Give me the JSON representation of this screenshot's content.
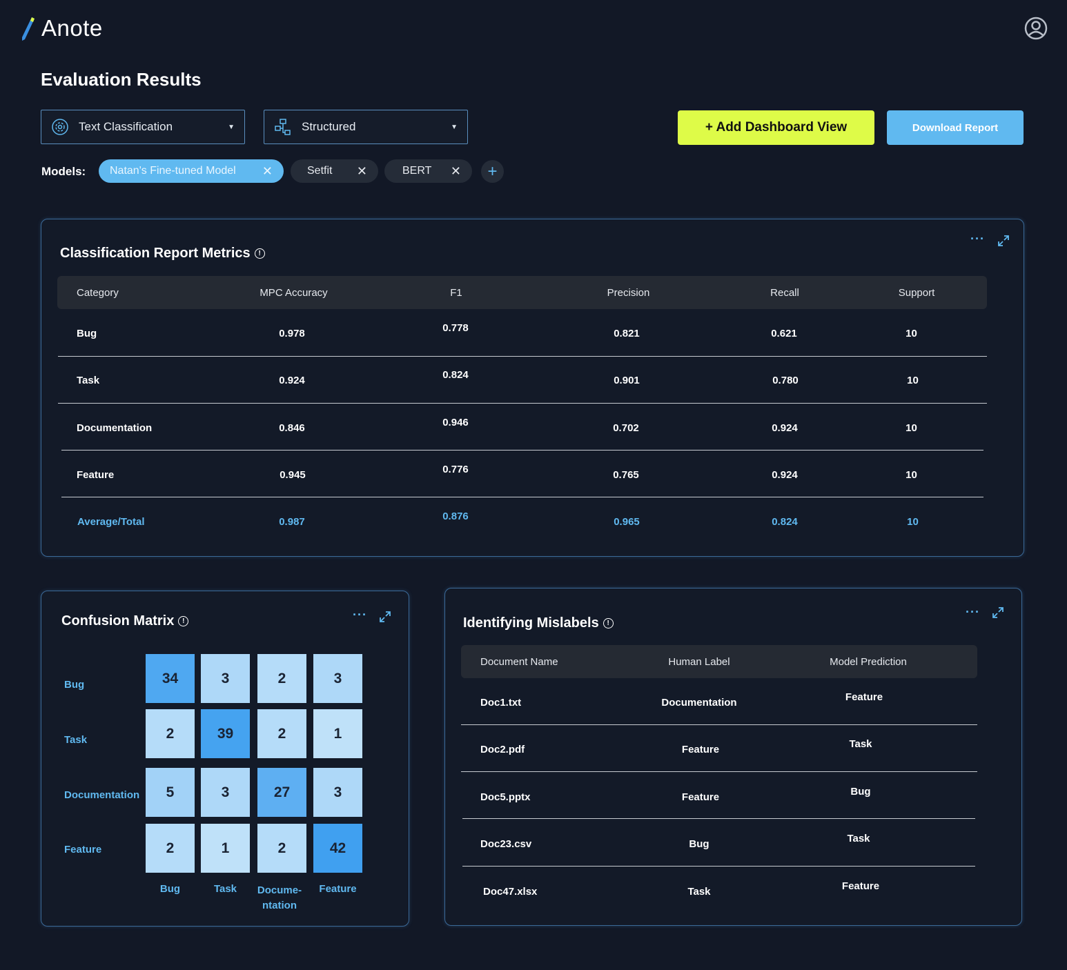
{
  "app": {
    "name": "Anote"
  },
  "page": {
    "title": "Evaluation Results"
  },
  "filters": {
    "task_select": {
      "value": "Text Classification",
      "icon": "gear-icon"
    },
    "data_select": {
      "value": "Structured",
      "icon": "flowchart-icon"
    }
  },
  "actions": {
    "add_dashboard": "+ Add Dashboard View",
    "download_report": "Download Report"
  },
  "models": {
    "label": "Models:",
    "chips": [
      {
        "label": "Natan's Fine-tuned Model",
        "active": true
      },
      {
        "label": "Setfit",
        "active": false
      },
      {
        "label": "BERT",
        "active": false
      }
    ],
    "add_label": "+"
  },
  "classification_report": {
    "title": "Classification Report Metrics",
    "columns": [
      "Category",
      "MPC Accuracy",
      "F1",
      "Precision",
      "Recall",
      "Support"
    ],
    "rows": [
      [
        "Bug",
        "0.978",
        "0.778",
        "0.821",
        "0.621",
        "10"
      ],
      [
        "Task",
        "0.924",
        "0.824",
        "0.901",
        "0.780",
        "10"
      ],
      [
        "Documentation",
        "0.846",
        "0.946",
        "0.702",
        "0.924",
        "10"
      ],
      [
        "Feature",
        "0.945",
        "0.776",
        "0.765",
        "0.924",
        "10"
      ]
    ],
    "total": [
      "Average/Total",
      "0.987",
      "0.876",
      "0.965",
      "0.824",
      "10"
    ]
  },
  "confusion_matrix": {
    "title": "Confusion Matrix",
    "row_labels": [
      "Bug",
      "Task",
      "Documentation",
      "Feature"
    ],
    "col_labels": [
      "Bug",
      "Task",
      "Docume-\nntation",
      "Feature"
    ],
    "values": [
      [
        34,
        3,
        2,
        3
      ],
      [
        2,
        39,
        2,
        1
      ],
      [
        5,
        3,
        27,
        3
      ],
      [
        2,
        1,
        2,
        42
      ]
    ]
  },
  "mislabels": {
    "title": "Identifying Mislabels",
    "columns": [
      "Document Name",
      "Human Label",
      "Model Prediction"
    ],
    "rows": [
      [
        "Doc1.txt",
        "Documentation",
        "Feature"
      ],
      [
        "Doc2.pdf",
        "Feature",
        "Task"
      ],
      [
        "Doc5.pptx",
        "Feature",
        "Bug"
      ],
      [
        "Doc23.csv",
        "Bug",
        "Task"
      ],
      [
        "Doc47.xlsx",
        "Task",
        "Feature"
      ]
    ]
  },
  "colors": {
    "accent": "#60b9f0",
    "primary_button": "#defb48",
    "background": "#121826"
  }
}
